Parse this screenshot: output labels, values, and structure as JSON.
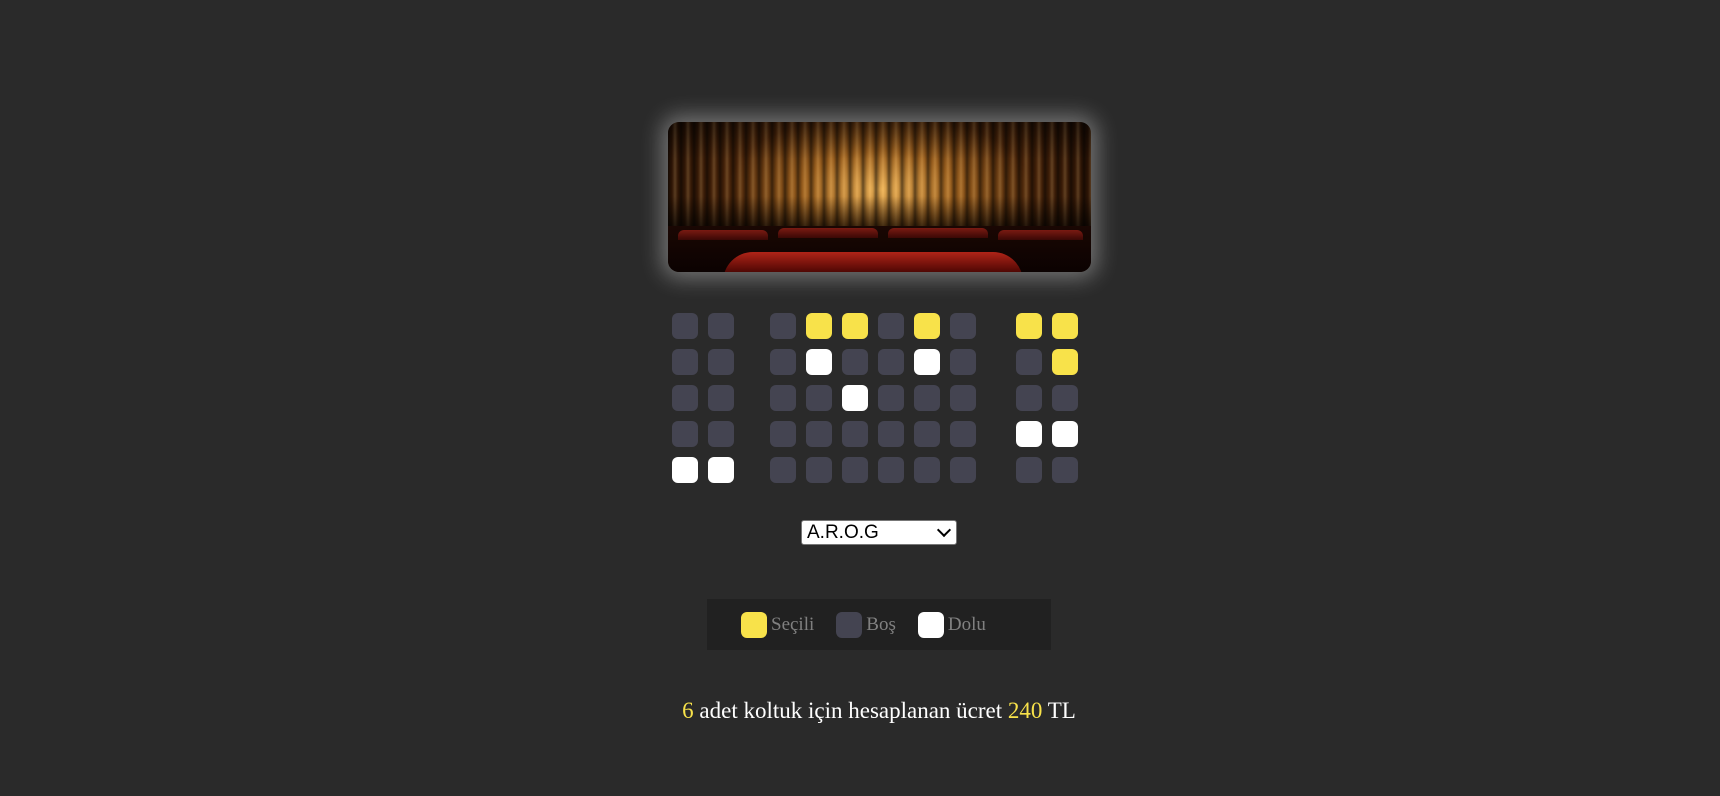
{
  "colors": {
    "background": "#2a2a2a",
    "seat_empty": "#444451",
    "seat_selected": "#f8e24a",
    "seat_full": "#ffffff",
    "legend_bg": "#212121"
  },
  "screen": {
    "image": "cinema-curtain-stage-image"
  },
  "seat_rows": [
    [
      "empty",
      "empty",
      "empty",
      "selected",
      "selected",
      "empty",
      "selected",
      "empty",
      "selected",
      "selected"
    ],
    [
      "empty",
      "empty",
      "empty",
      "full",
      "empty",
      "empty",
      "full",
      "empty",
      "empty",
      "selected"
    ],
    [
      "empty",
      "empty",
      "empty",
      "empty",
      "full",
      "empty",
      "empty",
      "empty",
      "empty",
      "empty"
    ],
    [
      "empty",
      "empty",
      "empty",
      "empty",
      "empty",
      "empty",
      "empty",
      "empty",
      "full",
      "full"
    ],
    [
      "full",
      "full",
      "empty",
      "empty",
      "empty",
      "empty",
      "empty",
      "empty",
      "empty",
      "empty"
    ]
  ],
  "movie_select": {
    "selected": "A.R.O.G"
  },
  "legend": {
    "selected_label": "Seçili",
    "empty_label": "Boş",
    "full_label": "Dolu"
  },
  "summary": {
    "count": "6",
    "text": " adet koltuk için hesaplanan ücret ",
    "price": "240",
    "currency": " TL"
  }
}
